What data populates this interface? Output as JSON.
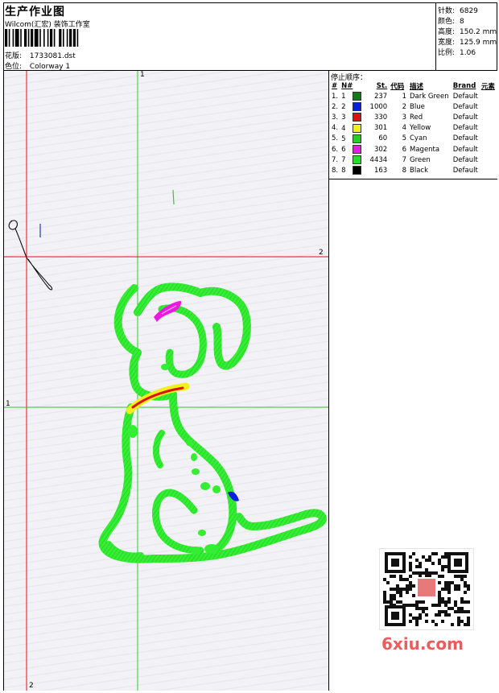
{
  "header": {
    "title": "生产作业图",
    "company": "Wilcom(汇宏) 装饰工作室",
    "pattern_label": "花版:",
    "pattern_value": "1733081.dst",
    "color_label": "色位:",
    "color_value": "Colorway 1"
  },
  "stats": [
    {
      "label": "针数:",
      "value": "6829"
    },
    {
      "label": "颜色:",
      "value": "8"
    },
    {
      "label": "高度:",
      "value": "150.2 mm"
    },
    {
      "label": "宽度:",
      "value": "125.9 mm"
    },
    {
      "label": "比例:",
      "value": "1.06"
    }
  ],
  "stop_sequence": {
    "caption": "停止顺序：",
    "headers": [
      "#",
      "N#",
      "St.",
      "代码",
      "描述",
      "Brand",
      "元素"
    ],
    "rows": [
      {
        "idx": "1.",
        "n": "1",
        "color": "#127a12",
        "st": "237",
        "code": "1",
        "desc": "Dark Green",
        "brand": "Default"
      },
      {
        "idx": "2.",
        "n": "2",
        "color": "#0a1ee0",
        "st": "1000",
        "code": "2",
        "desc": "Blue",
        "brand": "Default"
      },
      {
        "idx": "3.",
        "n": "3",
        "color": "#e01010",
        "st": "330",
        "code": "3",
        "desc": "Red",
        "brand": "Default"
      },
      {
        "idx": "4.",
        "n": "4",
        "color": "#f0f01a",
        "st": "301",
        "code": "4",
        "desc": "Yellow",
        "brand": "Default"
      },
      {
        "idx": "5.",
        "n": "5",
        "color": "#22d022",
        "st": "60",
        "code": "5",
        "desc": "Cyan",
        "brand": "Default"
      },
      {
        "idx": "6.",
        "n": "6",
        "color": "#ea1ae0",
        "st": "302",
        "code": "6",
        "desc": "Magenta",
        "brand": "Default"
      },
      {
        "idx": "7.",
        "n": "7",
        "color": "#22e022",
        "st": "4434",
        "code": "7",
        "desc": "Green",
        "brand": "Default"
      },
      {
        "idx": "8.",
        "n": "8",
        "color": "#000000",
        "st": "163",
        "code": "8",
        "desc": "Black",
        "brand": "Default"
      }
    ]
  },
  "guides": {
    "v1": "1",
    "h2": "2",
    "h1": "1",
    "v2": "2"
  },
  "watermark": "6xiu.com",
  "colors": {
    "guide_red": "#e01010",
    "guide_green": "#22d022",
    "stitch_green": "#33ee33"
  }
}
